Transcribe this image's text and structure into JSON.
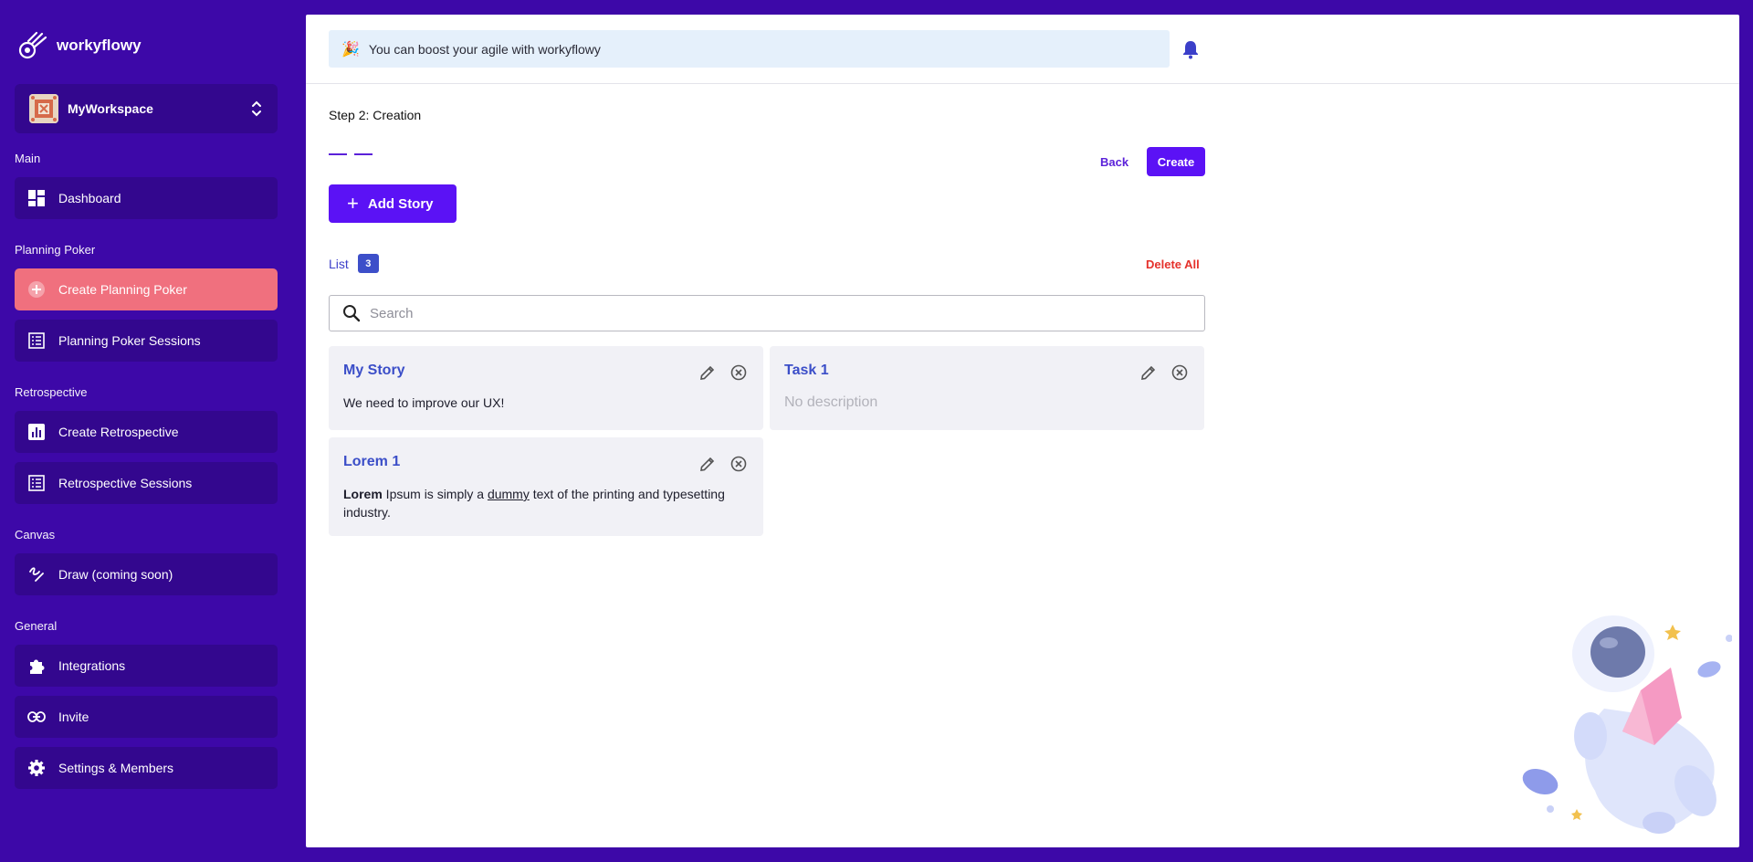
{
  "brand": {
    "name": "workyflowy"
  },
  "workspace": {
    "name": "MyWorkspace"
  },
  "sidebar": {
    "sections": [
      {
        "label": "Main"
      },
      {
        "label": "Planning Poker"
      },
      {
        "label": "Retrospective"
      },
      {
        "label": "Canvas"
      },
      {
        "label": "General"
      }
    ],
    "items": [
      {
        "label": "Dashboard",
        "icon": "dashboard-icon"
      },
      {
        "label": "Create Planning Poker",
        "icon": "plus-circle-icon",
        "active": true
      },
      {
        "label": "Planning Poker Sessions",
        "icon": "list-icon"
      },
      {
        "label": "Create Retrospective",
        "icon": "chart-icon"
      },
      {
        "label": "Retrospective Sessions",
        "icon": "list-icon"
      },
      {
        "label": "Draw (coming soon)",
        "icon": "draw-icon"
      },
      {
        "label": "Integrations",
        "icon": "puzzle-icon"
      },
      {
        "label": "Invite",
        "icon": "link-icon"
      },
      {
        "label": "Settings & Members",
        "icon": "gear-icon"
      }
    ]
  },
  "header": {
    "banner_emoji": "🎉",
    "banner_text": "You can boost your agile with workyflowy"
  },
  "main": {
    "step_title": "Step 2: Creation",
    "back_label": "Back",
    "create_label": "Create",
    "add_story_label": "Add Story",
    "list_label": "List",
    "list_count": "3",
    "delete_all_label": "Delete All",
    "search_placeholder": "Search"
  },
  "stories": [
    {
      "title": "My Story",
      "description": "We need to improve our UX!"
    },
    {
      "title": "Task 1",
      "description": "No description"
    },
    {
      "title": "Lorem 1",
      "description_bold": "Lorem",
      "description_part1": " Ipsum is simply a ",
      "description_underline": "dummy",
      "description_part2": " text of the printing and typesetting industry."
    }
  ],
  "colors": {
    "sidebar_bg": "#3d08a8",
    "nav_item_bg": "#33078e",
    "active_item": "#f0707e",
    "primary": "#5b12f5",
    "danger": "#e5312b",
    "card_bg": "#f1f1f6",
    "card_title": "#3b4ec8"
  }
}
